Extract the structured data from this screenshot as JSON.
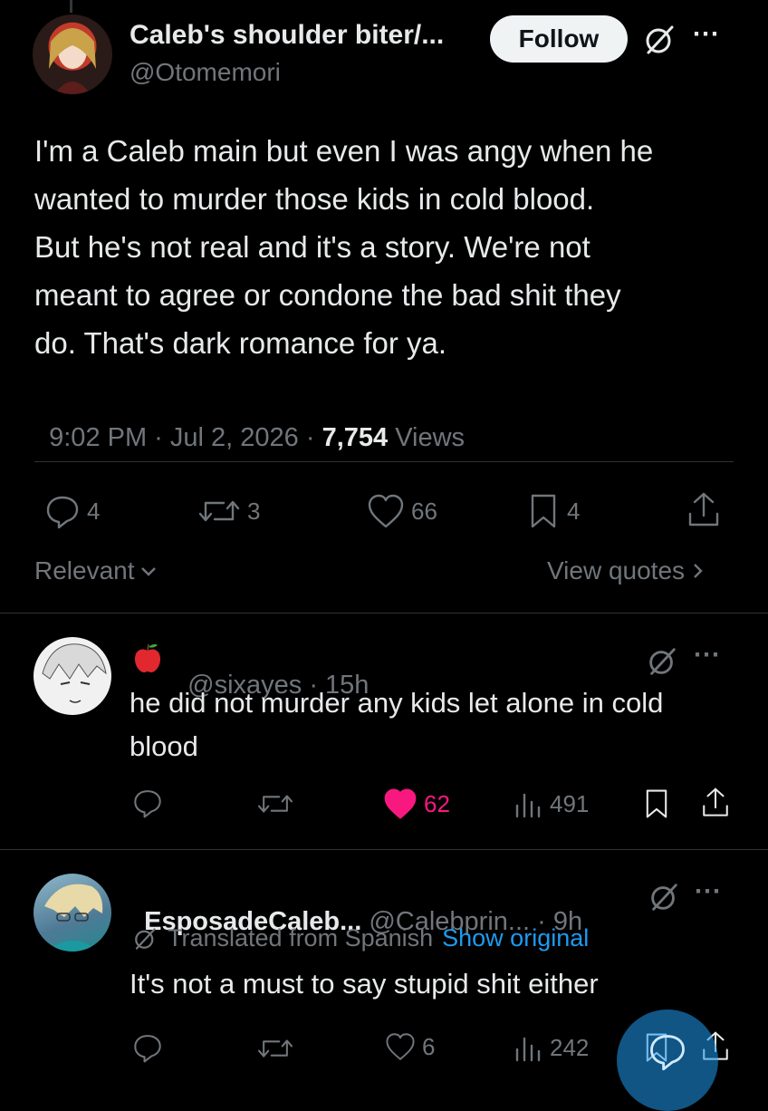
{
  "post": {
    "display_name": "Caleb's shoulder biter/...",
    "handle": "@Otomemori",
    "follow_label": "Follow",
    "text_lines": [
      "I'm a Caleb main but even I was angy when he",
      "wanted to murder those kids in cold blood.",
      "But he's not real and it's a story. We're not",
      "meant to agree or condone the bad shit they",
      "do. That's dark romance for ya."
    ],
    "timestamp": "9:02 PM · Jul 2, 2026 · ",
    "views_count": "7,754",
    "views_label": " Views",
    "stats": {
      "replies": "4",
      "reposts": "3",
      "likes": "66",
      "bookmarks": "4"
    },
    "icons": [
      "reply-icon",
      "repost-icon",
      "like-icon",
      "bookmark-icon",
      "share-icon",
      "grok-icon",
      "more-icon"
    ]
  },
  "filter": {
    "sort_label": "Relevant",
    "quotes_label": "View quotes"
  },
  "replies": [
    {
      "badge_icon": "apple-emoji",
      "handle": "@sixayes",
      "time": " · 15h",
      "text_lines": [
        "he did not murder any kids let alone in cold",
        "blood"
      ],
      "likes": "62",
      "views": "491",
      "liked": true,
      "like_color": "#f91880"
    },
    {
      "display_name": "EsposadeCaleb...",
      "handle": "@Calebprin...",
      "time": " · 9h",
      "translated_label": "Translated from Spanish",
      "show_original_label": "Show original",
      "text_lines": [
        "It's not a must to say stupid shit either"
      ],
      "likes": "6",
      "views": "242"
    }
  ],
  "colors": {
    "background": "#000000",
    "text": "#e7e9ea",
    "muted": "#71767b",
    "link": "#1d9bf0",
    "like": "#f91880",
    "fab": "#1d9bf0"
  }
}
